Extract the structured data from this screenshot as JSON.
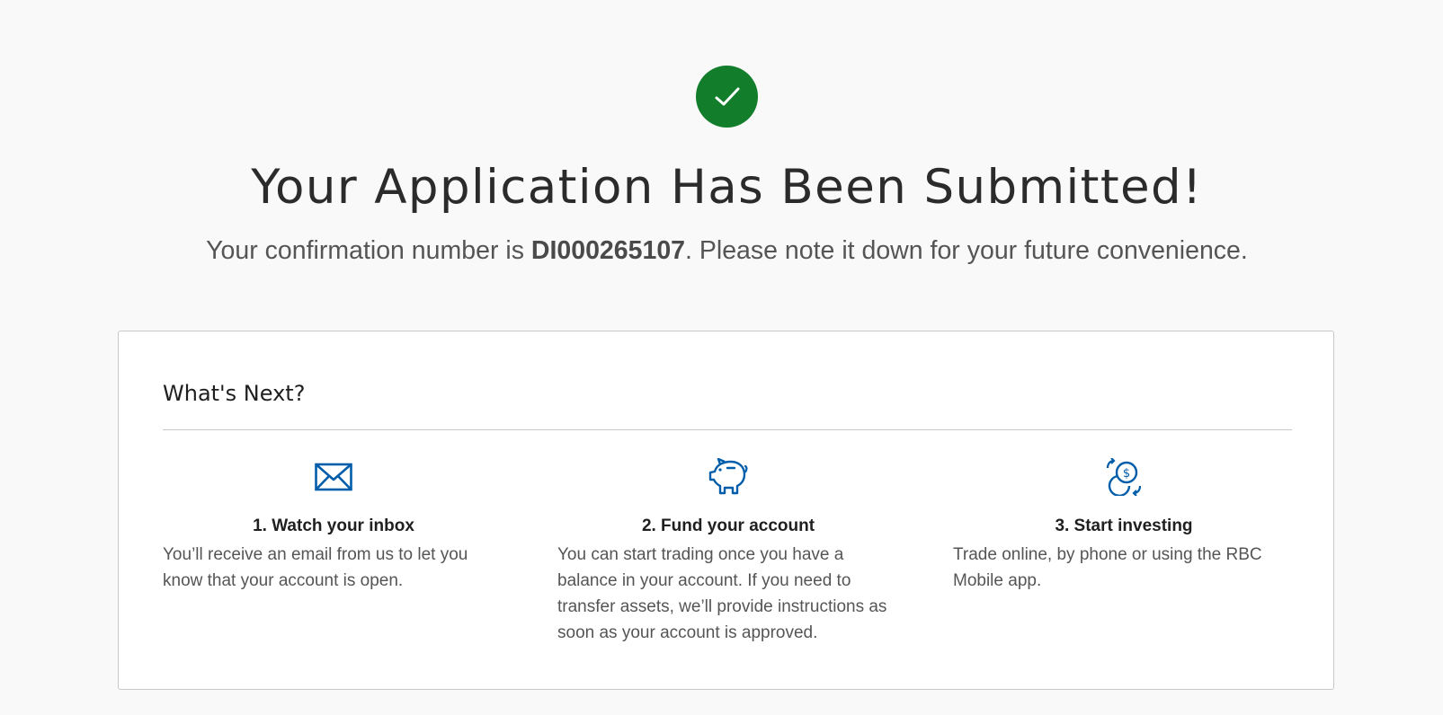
{
  "header": {
    "icon": "check-icon",
    "title": "Your Application Has Been Submitted!",
    "confirmation_prefix": "Your confirmation number is ",
    "confirmation_number": "DI000265107",
    "confirmation_suffix": ". Please note it down for your future convenience.",
    "success_color": "#127d2a"
  },
  "next": {
    "title": "What's Next?",
    "accent_color": "#005daa",
    "steps": [
      {
        "icon": "envelope-icon",
        "title": "1. Watch your inbox",
        "text": "You’ll receive an email from us to let you know that your account is open."
      },
      {
        "icon": "piggy-bank-icon",
        "title": "2. Fund your account",
        "text": "You can start trading once you have a balance in your account. If you need to transfer assets, we’ll provide instructions as soon as your account is approved."
      },
      {
        "icon": "exchange-icon",
        "title": "3. Start investing",
        "text": "Trade online, by phone or using the RBC Mobile app."
      }
    ]
  }
}
